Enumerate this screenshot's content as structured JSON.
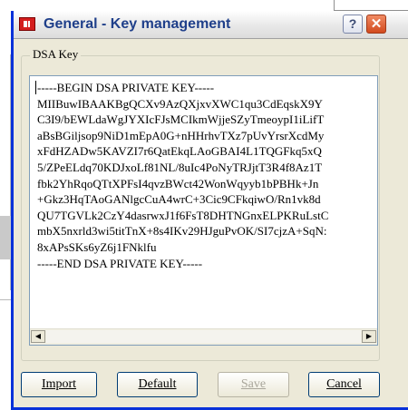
{
  "dialog": {
    "title": "General - Key management",
    "help_glyph": "?",
    "close_glyph": "✕",
    "group_label": "DSA Key",
    "key_text": "-----BEGIN DSA PRIVATE KEY-----\nMIIBuwIBAAKBgQCXv9AzQXjxvXWC1qu3CdEqskX9Y\nC3I9/bEWLdaWgJYXIcFJsMCIkmWjjeSZyTmeoypI1iLifT\naBsBGiljsop9NiD1mEpA0G+nHHrhvTXz7pUvYrsrXcdMy\nxFdHZADw5KAVZI7r6QatEkqLAoGBAI4L1TQGFkq5xQ\n5/ZPeELdq70KDJxoLf81NL/8uIc4PoNyTRJjtT3R4f8Az1T\nfbk2YhRqoQTtXPFsI4qvzBWct42WonWqyyb1bPBHk+Jn\n+Gkz3HqTAoGANlgcCuA4wrC+3Cic9CFkqiwO/Rn1vk8d\nQU7TGVLk2CzY4dasrwxJ1f6FsT8DHTNGnxELPKRuLstC\nmbX5nxrld3wi5titTnX+8s4IKv29HJguPvOK/SI7cjzA+SqN:\n8xAPsSKs6yZ6j1FNklfu\n-----END DSA PRIVATE KEY-----"
  },
  "buttons": {
    "import": "Import",
    "default": "Default",
    "save": "Save",
    "cancel": "Cancel"
  },
  "colors": {
    "title_text": "#1f3f8a",
    "close_button": "#d24a1e",
    "dialog_bg": "#ece9d8",
    "border_blue": "#0831d9"
  },
  "icons": {
    "app": "app-red-icon",
    "help": "help-icon",
    "close": "close-icon",
    "scroll_left": "scroll-left-icon",
    "scroll_right": "scroll-right-icon"
  },
  "scroll_glyphs": {
    "left": "◀",
    "right": "▶"
  }
}
